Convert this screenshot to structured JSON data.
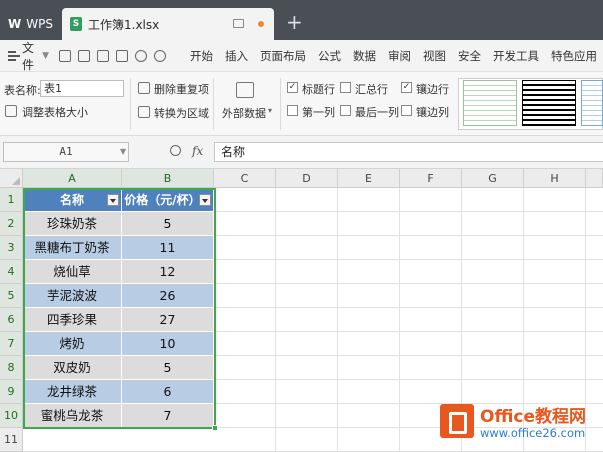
{
  "titlebar": {
    "app_tab": "WPS",
    "doc_tab": "工作簿1.xlsx",
    "doc_badge": "S",
    "add_tab": "+"
  },
  "menubar": {
    "file": "文件",
    "tabs": [
      "开始",
      "插入",
      "页面布局",
      "公式",
      "数据",
      "审阅",
      "视图",
      "安全",
      "开发工具",
      "特色应用"
    ]
  },
  "ribbon": {
    "table_name_label": "表名称:",
    "table_name_value": "表1",
    "resize_label": "调整表格大小",
    "remove_dup_label": "删除重复项",
    "convert_label": "转换为区域",
    "external_data_label": "外部数据",
    "options": [
      {
        "label": "标题行",
        "checked": true
      },
      {
        "label": "汇总行",
        "checked": false
      },
      {
        "label": "镶边行",
        "checked": true
      },
      {
        "label": "第一列",
        "checked": false
      },
      {
        "label": "最后一列",
        "checked": false
      },
      {
        "label": "镶边列",
        "checked": false
      }
    ]
  },
  "formula_bar": {
    "name_box": "A1",
    "fx": "fx",
    "content": "名称"
  },
  "sheet": {
    "columns": [
      "A",
      "B",
      "C",
      "D",
      "E",
      "F",
      "G",
      "H"
    ],
    "rows": [
      "1",
      "2",
      "3",
      "4",
      "5",
      "6",
      "7",
      "8",
      "9",
      "10",
      "11"
    ],
    "header": [
      "名称",
      "价格（元/杯）"
    ],
    "data": [
      [
        "珍珠奶茶",
        "5"
      ],
      [
        "黑糖布丁奶茶",
        "11"
      ],
      [
        "烧仙草",
        "12"
      ],
      [
        "芋泥波波",
        "26"
      ],
      [
        "四季珍果",
        "27"
      ],
      [
        "烤奶",
        "10"
      ],
      [
        "双皮奶",
        "5"
      ],
      [
        "龙井绿茶",
        "6"
      ],
      [
        "蜜桃乌龙茶",
        "7"
      ]
    ]
  },
  "watermark": {
    "title": "Office教程网",
    "url": "www.office26.com"
  },
  "colors": {
    "header_fill": "#4f81bd",
    "band_gray": "#dcdcdc",
    "band_blue": "#b8cce4",
    "selection": "#3ea84a"
  }
}
